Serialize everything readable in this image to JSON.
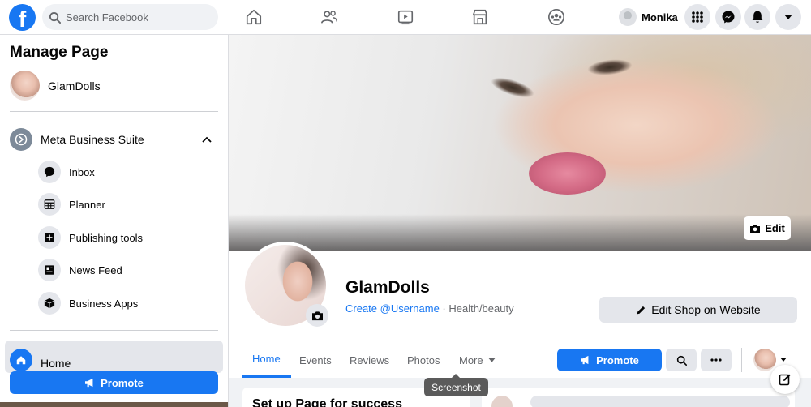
{
  "topbar": {
    "logo": "f",
    "search_placeholder": "Search Facebook",
    "nav_icons": [
      "home-icon",
      "friends-icon",
      "watch-icon",
      "marketplace-icon",
      "groups-icon"
    ],
    "user_name": "Monika",
    "right_icons": [
      "menu-grid-icon",
      "messenger-icon",
      "notifications-icon",
      "account-caret-icon"
    ]
  },
  "sidebar": {
    "title": "Manage Page",
    "page_name": "GlamDolls",
    "business_suite": "Meta Business Suite",
    "items": [
      {
        "label": "Inbox",
        "icon": "inbox-icon"
      },
      {
        "label": "Planner",
        "icon": "planner-icon"
      },
      {
        "label": "Publishing tools",
        "icon": "publishing-tools-icon"
      },
      {
        "label": "News Feed",
        "icon": "news-feed-icon"
      },
      {
        "label": "Business Apps",
        "icon": "business-apps-icon"
      }
    ],
    "home_label": "Home",
    "promote_label": "Promote"
  },
  "cover": {
    "edit_label": "Edit"
  },
  "profile": {
    "name": "GlamDolls",
    "username_link": "Create @Username",
    "separator": " · ",
    "category": "Health/beauty",
    "edit_shop_label": "Edit Shop on Website"
  },
  "tabs": [
    {
      "label": "Home",
      "active": true
    },
    {
      "label": "Events",
      "active": false
    },
    {
      "label": "Reviews",
      "active": false
    },
    {
      "label": "Photos",
      "active": false
    },
    {
      "label": "More",
      "active": false
    }
  ],
  "actions": {
    "promote_label": "Promote"
  },
  "tooltip": "Screenshot",
  "bottom": {
    "card_title": "Set up Page for success"
  },
  "colors": {
    "accent": "#1877f2",
    "background": "#f0f2f5",
    "secondary_button": "#e4e6eb",
    "text_secondary": "#65676b"
  }
}
